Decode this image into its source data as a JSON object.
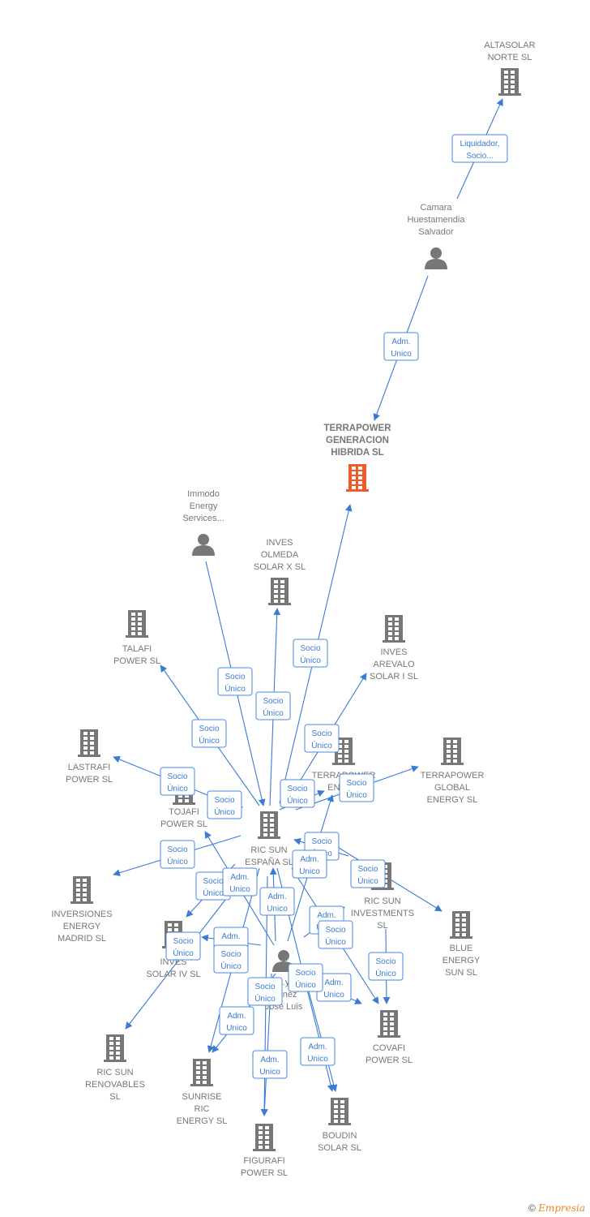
{
  "colors": {
    "edge": "#3a7bd5",
    "node": "#777777",
    "focus_node": "#f05a28"
  },
  "nodes": [
    {
      "id": "altasolar",
      "type": "company",
      "label": [
        "ALTASOLAR",
        "NORTE  SL"
      ]
    },
    {
      "id": "camara",
      "type": "person",
      "label": [
        "Camara",
        "Huestamendia",
        "Salvador"
      ]
    },
    {
      "id": "terrapower_gen",
      "type": "company",
      "focus": true,
      "label": [
        "TERRAPOWER",
        "GENERACION",
        "HIBRIDA  SL"
      ]
    },
    {
      "id": "immodo",
      "type": "person",
      "label": [
        "Immodo",
        "Energy",
        "Services..."
      ]
    },
    {
      "id": "inves_olmeda",
      "type": "company",
      "label": [
        "INVES",
        "OLMEDA",
        "SOLAR X  SL"
      ]
    },
    {
      "id": "talafi",
      "type": "company",
      "label": [
        "TALAFI",
        "POWER  SL"
      ]
    },
    {
      "id": "inves_arevalo",
      "type": "company",
      "label": [
        "INVES",
        "AREVALO",
        "SOLAR I  SL"
      ]
    },
    {
      "id": "lastrafi",
      "type": "company",
      "label": [
        "LASTRAFI",
        "POWER  SL"
      ]
    },
    {
      "id": "terrapower_ener",
      "type": "company",
      "label": [
        "TERRAPOWER",
        "ENER..."
      ]
    },
    {
      "id": "terrapower_global",
      "type": "company",
      "label": [
        "TERRAPOWER",
        "GLOBAL",
        "ENERGY  SL"
      ]
    },
    {
      "id": "tojafi",
      "type": "company",
      "label": [
        "TOJAFI",
        "POWER  SL"
      ]
    },
    {
      "id": "ric_sun_espana",
      "type": "company",
      "label": [
        "RIC SUN",
        "ESPAÑA  SL"
      ]
    },
    {
      "id": "inversiones_madrid",
      "type": "company",
      "label": [
        "INVERSIONES",
        "ENERGY",
        "MADRID  SL"
      ]
    },
    {
      "id": "ric_sun_investments",
      "type": "company",
      "label": [
        "RIC SUN",
        "INVESTMENTS",
        "SL"
      ]
    },
    {
      "id": "blue_energy",
      "type": "company",
      "label": [
        "BLUE",
        "ENERGY",
        "SUN  SL"
      ]
    },
    {
      "id": "inves_solar_iv",
      "type": "company",
      "label": [
        "INVES",
        "SOLAR IV SL"
      ]
    },
    {
      "id": "jose_luis",
      "type": "person",
      "label": [
        "...y",
        "...enez",
        "Jose Luis"
      ]
    },
    {
      "id": "covafi",
      "type": "company",
      "label": [
        "COVAFI",
        "POWER  SL"
      ]
    },
    {
      "id": "ric_sun_renovables",
      "type": "company",
      "label": [
        "RIC SUN",
        "RENOVABLES",
        "SL"
      ]
    },
    {
      "id": "sunrise",
      "type": "company",
      "label": [
        "SUNRISE",
        "RIC",
        "ENERGY  SL"
      ]
    },
    {
      "id": "boudin",
      "type": "company",
      "label": [
        "BOUDIN",
        "SOLAR SL"
      ]
    },
    {
      "id": "figurafi",
      "type": "company",
      "label": [
        "FIGURAFI",
        "POWER  SL"
      ]
    }
  ],
  "edges": [
    {
      "from": "camara",
      "to": "altasolar",
      "label": [
        "Liquidador,",
        "Socio..."
      ]
    },
    {
      "from": "camara",
      "to": "terrapower_gen",
      "label": [
        "Adm.",
        "Unico"
      ]
    },
    {
      "from": "ric_sun_espana",
      "to": "terrapower_gen",
      "label": [
        "Socio",
        "Único"
      ]
    },
    {
      "from": "immodo",
      "to": "ric_sun_espana",
      "label": [
        "Socio",
        "Único"
      ]
    },
    {
      "from": "ric_sun_espana",
      "to": "inves_olmeda",
      "label": [
        "Socio",
        "Único"
      ]
    },
    {
      "from": "ric_sun_espana",
      "to": "talafi",
      "label": [
        "Socio",
        "Único"
      ]
    },
    {
      "from": "ric_sun_espana",
      "to": "inves_arevalo",
      "label": [
        "Socio",
        "Único"
      ]
    },
    {
      "from": "ric_sun_espana",
      "to": "lastrafi",
      "label": [
        "Socio",
        "Único"
      ]
    },
    {
      "from": "ric_sun_espana",
      "to": "tojafi",
      "label": [
        "Socio",
        "Único"
      ]
    },
    {
      "from": "ric_sun_espana",
      "to": "terrapower_ener",
      "label": [
        "Socio",
        "Único"
      ]
    },
    {
      "from": "ric_sun_espana",
      "to": "terrapower_global",
      "label": [
        "Socio",
        "Único"
      ]
    },
    {
      "from": "ric_sun_espana",
      "to": "inversiones_madrid",
      "label": [
        "Socio",
        "Único"
      ]
    },
    {
      "from": "ric_sun_espana",
      "to": "inves_solar_iv",
      "label": [
        "Socio",
        "Único"
      ]
    },
    {
      "from": "ric_sun_investments",
      "to": "ric_sun_espana",
      "label": [
        "Socio",
        "Único"
      ]
    },
    {
      "from": "ric_sun_espana",
      "to": "blue_energy",
      "label": [
        "Socio",
        "Único"
      ]
    },
    {
      "from": "jose_luis",
      "to": "tojafi",
      "label": [
        "Adm.",
        "Unico"
      ]
    },
    {
      "from": "jose_luis",
      "to": "ric_sun_espana",
      "label": [
        "Adm.",
        "Unico"
      ]
    },
    {
      "from": "jose_luis",
      "to": "terrapower_ener",
      "label": [
        "Adm.",
        "Unico"
      ]
    },
    {
      "from": "jose_luis",
      "to": "ric_sun_investments",
      "label": [
        "Adm.",
        "Unico"
      ]
    },
    {
      "from": "ric_sun_espana",
      "to": "covafi",
      "label": [
        "Socio",
        "Único"
      ]
    },
    {
      "from": "ric_sun_investments",
      "to": "covafi",
      "label": [
        "Socio",
        "Único"
      ]
    },
    {
      "from": "jose_luis",
      "to": "inves_solar_iv",
      "label": [
        "Adm.",
        "Unico"
      ]
    },
    {
      "from": "ric_sun_espana",
      "to": "sunrise",
      "label": [
        "Socio",
        "Único"
      ]
    },
    {
      "from": "ric_sun_espana",
      "to": "ric_sun_renovables",
      "label": [
        "Socio",
        "Único"
      ]
    },
    {
      "from": "jose_luis",
      "to": "covafi",
      "label": [
        "Adm.",
        "Unico"
      ]
    },
    {
      "from": "ric_sun_espana",
      "to": "boudin",
      "label": [
        "Socio",
        "Único"
      ]
    },
    {
      "from": "ric_sun_espana",
      "to": "figurafi",
      "label": [
        "Socio",
        "Único"
      ]
    },
    {
      "from": "jose_luis",
      "to": "sunrise",
      "label": [
        "Adm.",
        "Unico"
      ]
    },
    {
      "from": "jose_luis",
      "to": "figurafi",
      "label": [
        "Adm.",
        "Unico"
      ]
    },
    {
      "from": "jose_luis",
      "to": "boudin",
      "label": [
        "Adm.",
        "Unico"
      ]
    }
  ],
  "footer": {
    "copyright_symbol": "©",
    "brand": "Empresia"
  }
}
